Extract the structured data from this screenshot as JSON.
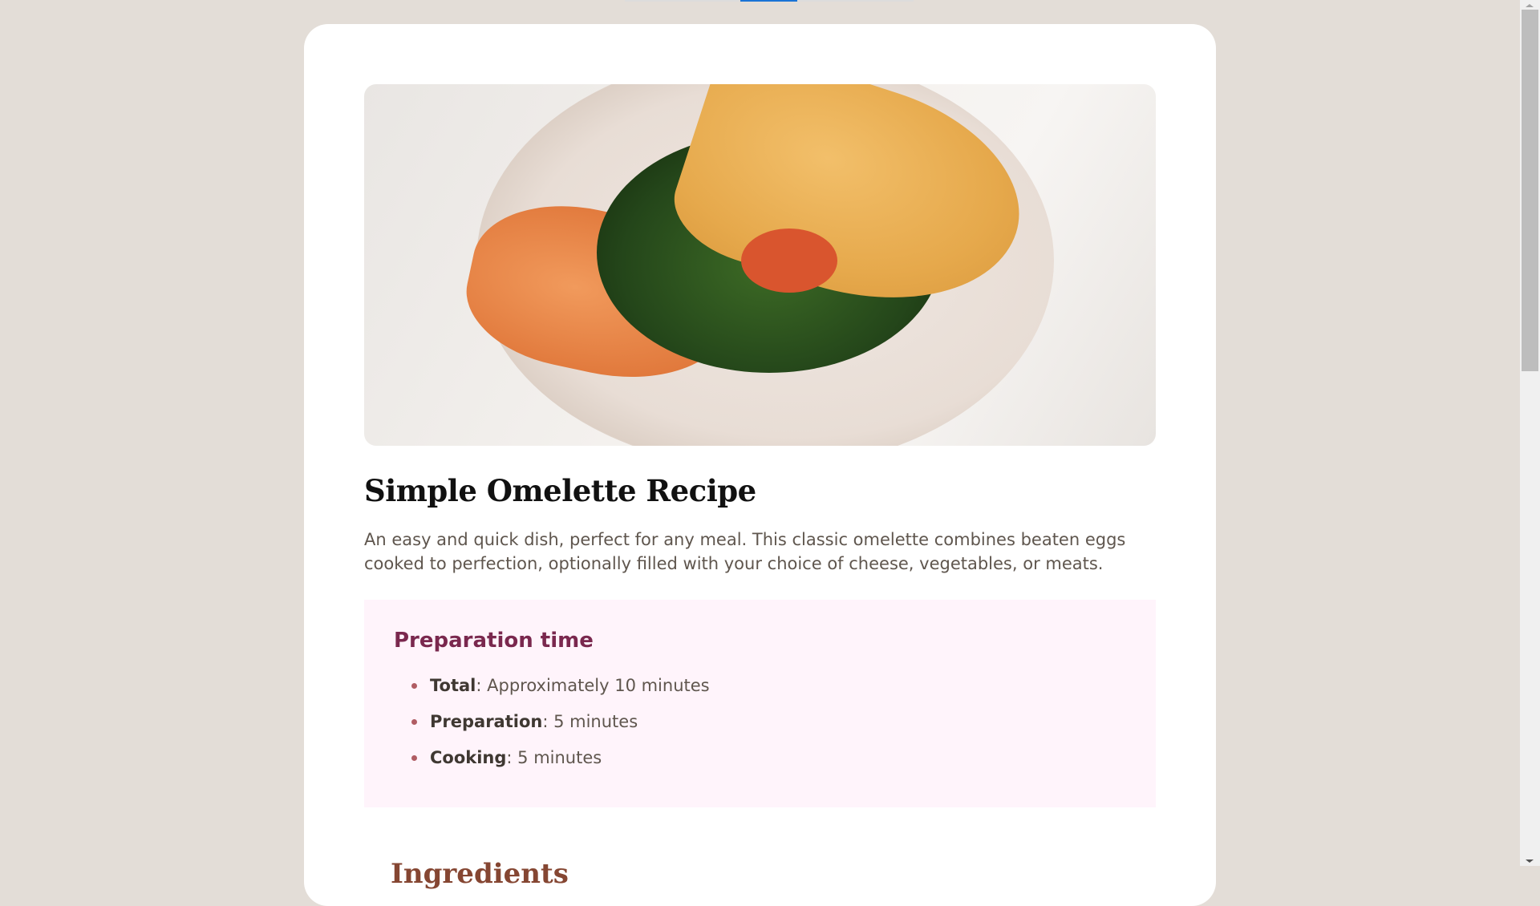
{
  "recipe": {
    "title": "Simple Omelette Recipe",
    "description": "An easy and quick dish, perfect for any meal. This classic omelette combines beaten eggs cooked to perfection, optionally filled with your choice of cheese, vegetables, or meats.",
    "preparation": {
      "heading": "Preparation time",
      "items": [
        {
          "label": "Total",
          "value": ": Approximately 10 minutes"
        },
        {
          "label": "Preparation",
          "value": ": 5 minutes"
        },
        {
          "label": "Cooking",
          "value": ": 5 minutes"
        }
      ]
    },
    "next_heading": "Ingredients"
  },
  "colors": {
    "accent": "#7a284e",
    "prep_bg": "#fff4fb",
    "heading_brown": "#854632",
    "page_bg": "#e3ddd7"
  }
}
